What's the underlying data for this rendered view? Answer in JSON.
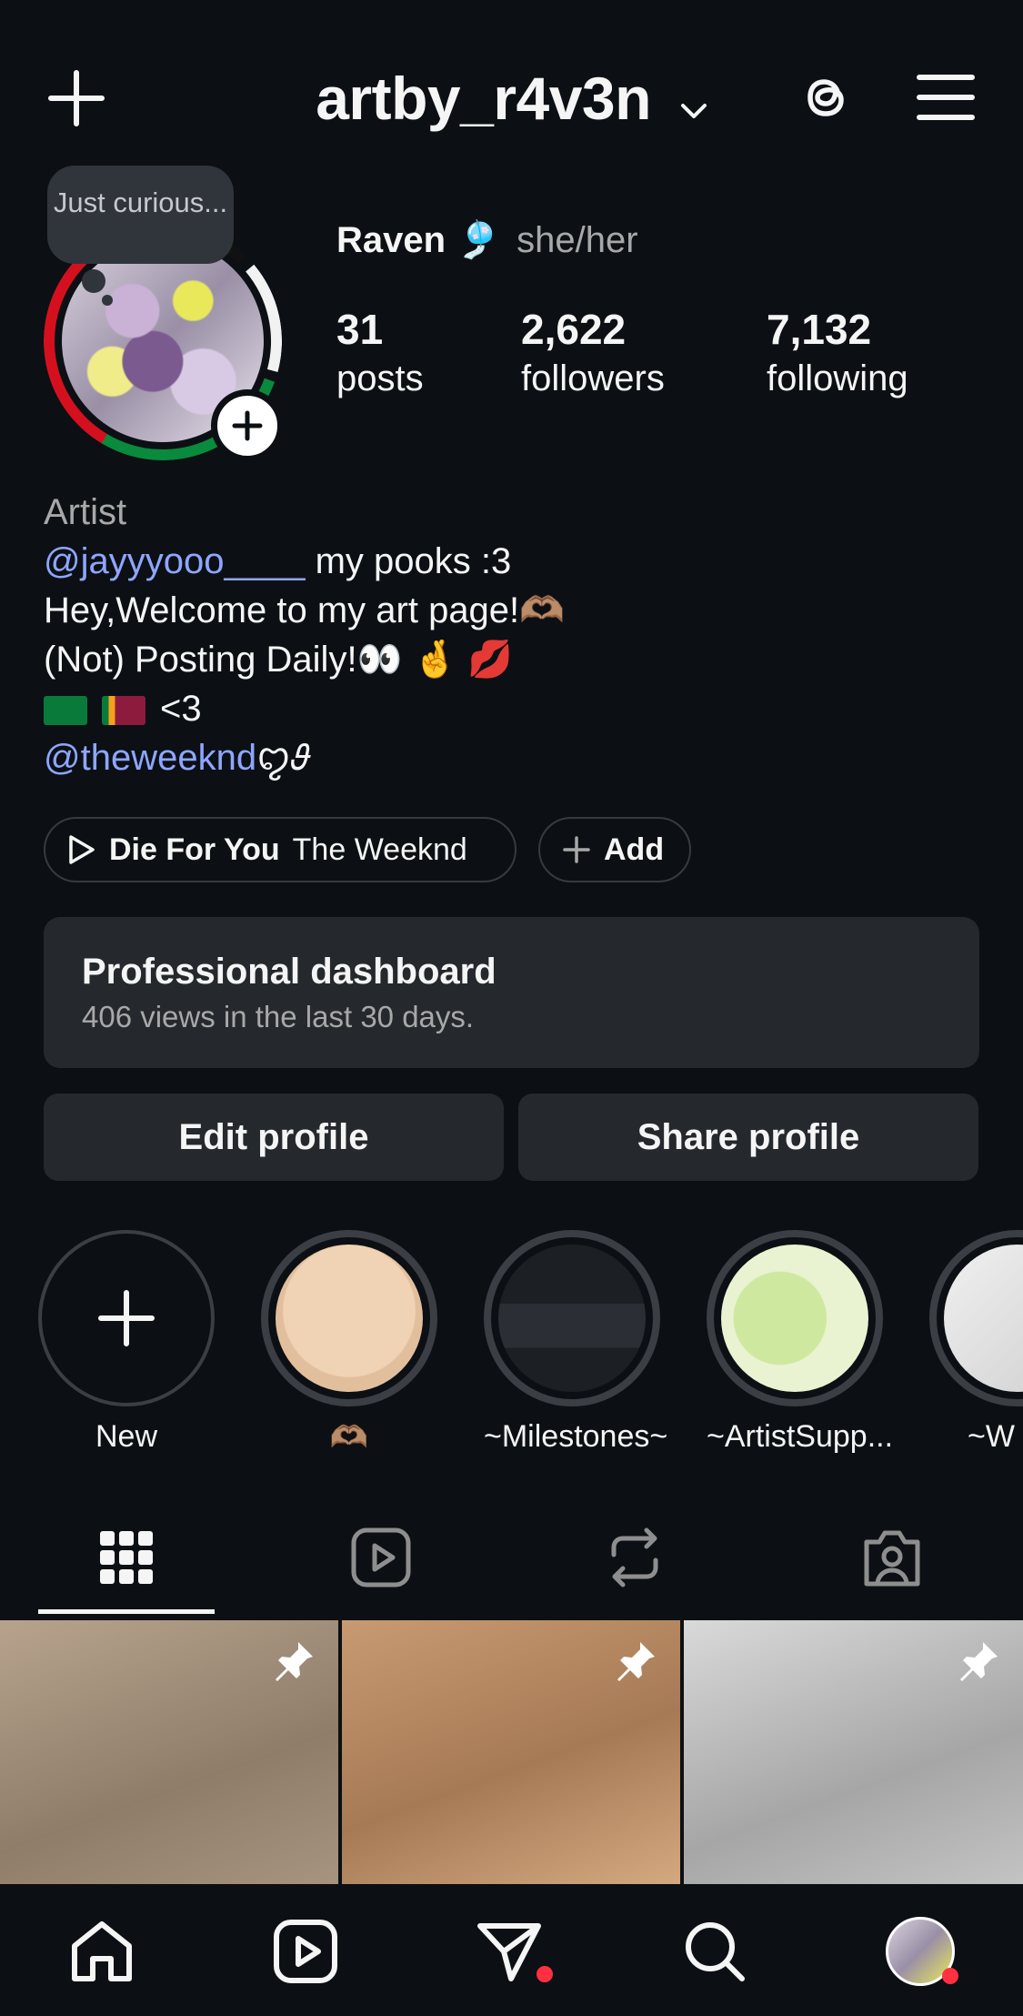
{
  "header": {
    "username": "artby_r4v3n",
    "icons": [
      "plus-icon",
      "chevron-down-icon",
      "threads-icon",
      "menu-icon"
    ]
  },
  "note": {
    "text": "Just curious..."
  },
  "profile": {
    "display_name": "Raven 🎐",
    "pronouns": "she/her",
    "stats": [
      {
        "value": "31",
        "label": "posts"
      },
      {
        "value": "2,622",
        "label": "followers"
      },
      {
        "value": "7,132",
        "label": "following"
      }
    ]
  },
  "bio": {
    "category": "Artist",
    "mention1": "@jayyyooo____",
    "line1_rest": " my pooks :3",
    "line2": "Hey,Welcome to my art page!🫶🏽",
    "line3": "(Not) Posting Daily!👀 🤞 💋",
    "line4": "<3",
    "mention2": "@theweeknd",
    "mention2_suffix": "ꨄ𝜗"
  },
  "music": {
    "song": "Die For You",
    "artist": "The Weeknd",
    "add_label": "Add"
  },
  "dashboard": {
    "title": "Professional dashboard",
    "subtitle": "406 views in the last 30 days."
  },
  "buttons": {
    "edit": "Edit profile",
    "share": "Share profile"
  },
  "highlights": [
    {
      "label": "New"
    },
    {
      "label": "🫶🏽"
    },
    {
      "label": "~Milestones~"
    },
    {
      "label": "~ArtistSupp..."
    },
    {
      "label": "~W"
    }
  ],
  "tabs": [
    "grid-icon",
    "reels-icon",
    "reposts-icon",
    "tagged-icon"
  ],
  "bottom_nav": [
    "home-icon",
    "reels-icon",
    "messages-icon",
    "search-icon",
    "profile-avatar"
  ],
  "colors": {
    "background": "#0c1014",
    "link": "#8ea6ff",
    "card": "#25292e",
    "notification": "#ff3040"
  }
}
